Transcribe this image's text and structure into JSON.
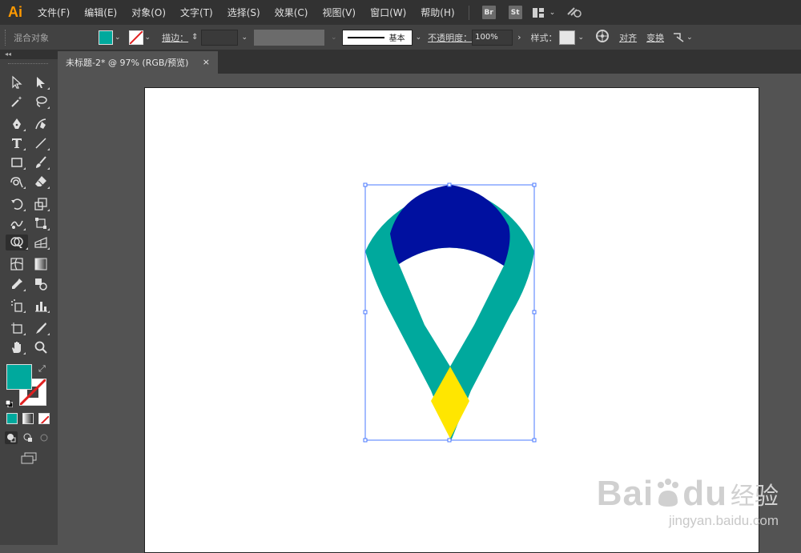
{
  "app": {
    "logo": "Ai"
  },
  "menu": {
    "items": [
      "文件(F)",
      "编辑(E)",
      "对象(O)",
      "文字(T)",
      "选择(S)",
      "效果(C)",
      "视图(V)",
      "窗口(W)",
      "帮助(H)"
    ],
    "bridge_badge": "Br",
    "stock_badge": "St"
  },
  "control_bar": {
    "selection_type": "混合对象",
    "stroke_label": "描边：",
    "stroke_profile": "基本",
    "opacity_label": "不透明度：",
    "opacity_value": "100%",
    "style_label": "样式：",
    "align_label": "对齐",
    "transform_label": "变换",
    "fill_color": "#00a99d",
    "style_swatch_color": "#e6e6e6"
  },
  "document": {
    "tab_title": "未标题-2* @ 97% (RGB/预览)",
    "close_glyph": "×"
  },
  "toolbox": {
    "collapse_glyph": "◂◂",
    "fill_color": "#00a99d"
  },
  "artwork": {
    "ribbon_color": "#00a99d",
    "top_color": "#0010a0",
    "tip_color": "#ffe600",
    "selection_color": "#4a78ff"
  },
  "watermark": {
    "brand": "Bai",
    "brand_suffix": "du",
    "cn_text": "经验",
    "url": "jingyan.baidu.com"
  }
}
